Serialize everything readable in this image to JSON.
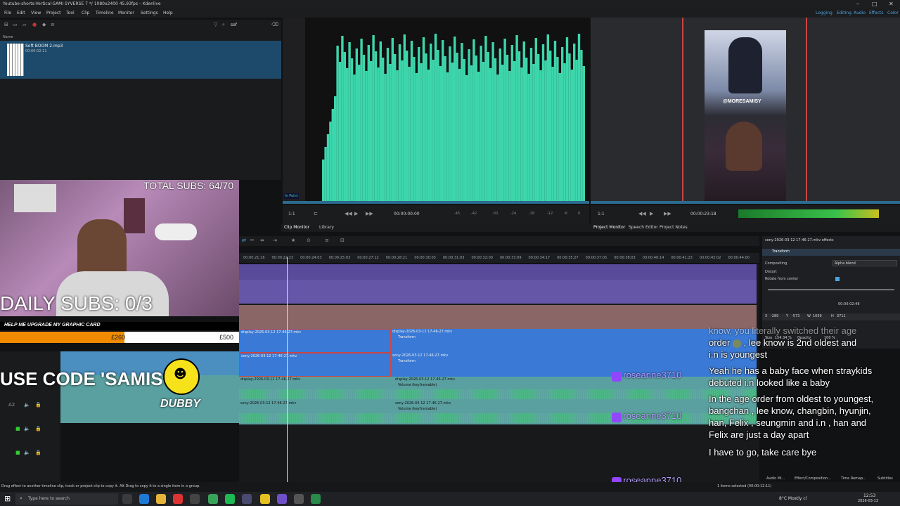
{
  "window": {
    "title": "Youtube-shorts-Vertical-SAMI SYVERSE 7 */ 1080x2400 45.93fps – Kdenlive"
  },
  "menu": [
    "File",
    "Edit",
    "View",
    "Project",
    "Tool",
    "Clip",
    "Timeline",
    "Monitor",
    "Settings",
    "Help"
  ],
  "workspaces": [
    "Logging",
    "Editing",
    "Audio",
    "Effects",
    "Color"
  ],
  "bin": {
    "search_value": "sof",
    "column_name": "Name",
    "clip_name": "Soft BOOM 2.mp3",
    "clip_duration": "00:00:02:11"
  },
  "clip_monitor": {
    "in_point_label": "In Point",
    "timecode": "00:00:00:00",
    "zoom": "1:1",
    "ruler": [
      "-45",
      "-42",
      "-30",
      "-24",
      "-18",
      "-12",
      "-6",
      "0"
    ],
    "accent": "#3dd6ac"
  },
  "project_monitor": {
    "timecode": "00:00:23:18",
    "zoom": "1:1",
    "overlay_text": "@MORESAMISY"
  },
  "monitor_tabs": {
    "clip_monitor": "Clip Monitor",
    "library": "Library",
    "project_monitor": "Project Monitor",
    "speech_editor": "Speech Editor",
    "project_notes": "Project Notes"
  },
  "ruler": [
    "00:00:21:16",
    "00:00:22:23",
    "00:00:24:03",
    "00:00:25:03",
    "00:00:27:12",
    "00:00:28:21",
    "00:00:30:03",
    "00:00:31:03",
    "00:00:32:00",
    "00:00:33:09",
    "00:00:34:17",
    "00:00:35:27",
    "00:00:37:05",
    "00:00:38:03",
    "00:00:40:14",
    "00:00:41:23",
    "00:00:43:02",
    "00:00:44:00"
  ],
  "tracks": {
    "clip_a": "display-2026-03-12 17-46-27.mkv",
    "clip_b": "sony-2026-03-12 17-46-27.mkv",
    "transform": "Transform",
    "volume": "Volume (keyframable)",
    "a2": "A2"
  },
  "effects": {
    "header": "sony-2026-03-12 17-46-27.mkv effects",
    "effect_name": "Transform",
    "compositing_label": "Compositing",
    "compositing_value": "Alpha blend",
    "distort_label": "Distort",
    "rotate_label": "Rotate from center",
    "timecode": "00:00:02:48",
    "x_label": "X",
    "x_value": "-289",
    "y_label": "Y",
    "y_value": "-573",
    "w_label": "W",
    "w_value": "1659",
    "h_label": "H",
    "h_value": "3711",
    "size_label": "Size",
    "size_value": "154.34 %",
    "opacity_label": "Opacity",
    "opacity_value": "100 %"
  },
  "stream": {
    "total_subs": "TOTAL SUBS: 64/70",
    "daily_subs": "DAILY SUBS: 0/3",
    "gpu_title": "HELP ME UPGRADE MY GRAPHIC CARD",
    "gpu_current": "£260",
    "gpu_goal": "£500",
    "gpu_progress": 0.52,
    "code": "USE CODE 'SAMISY'",
    "dubby": "DUBBY"
  },
  "chat": {
    "user": "roseanne3710",
    "msg0": "know, you literally switched their age",
    "msg0b": "order",
    "msg0c": ", lee know is 2nd oldest and",
    "msg0d": "i.n is youngest",
    "msg1": "Yeah he has a baby face when straykids debuted i.n looked like a baby",
    "msg2": "In the age order from oldest to youngest, bangchan , lee know, changbin, hyunjin, han, Felix , seungmin and i.n , han and Felix are just a day apart",
    "msg3": "I have to go, take care bye"
  },
  "status": {
    "hint": "Drag effect to another timeline clip, track or project clip to copy it. Alt Drag to copy it to a single item in a group.",
    "selected": "1 items selected (00:00:12:11)",
    "tabs": [
      "Audio Mi...",
      "Effect/Composition...",
      "Time Remap...",
      "Subtitles"
    ]
  },
  "taskbar": {
    "search_placeholder": "Type here to search",
    "weather": "8°C  Mostly cl",
    "time": "12:53",
    "date": "2026-03-13"
  }
}
